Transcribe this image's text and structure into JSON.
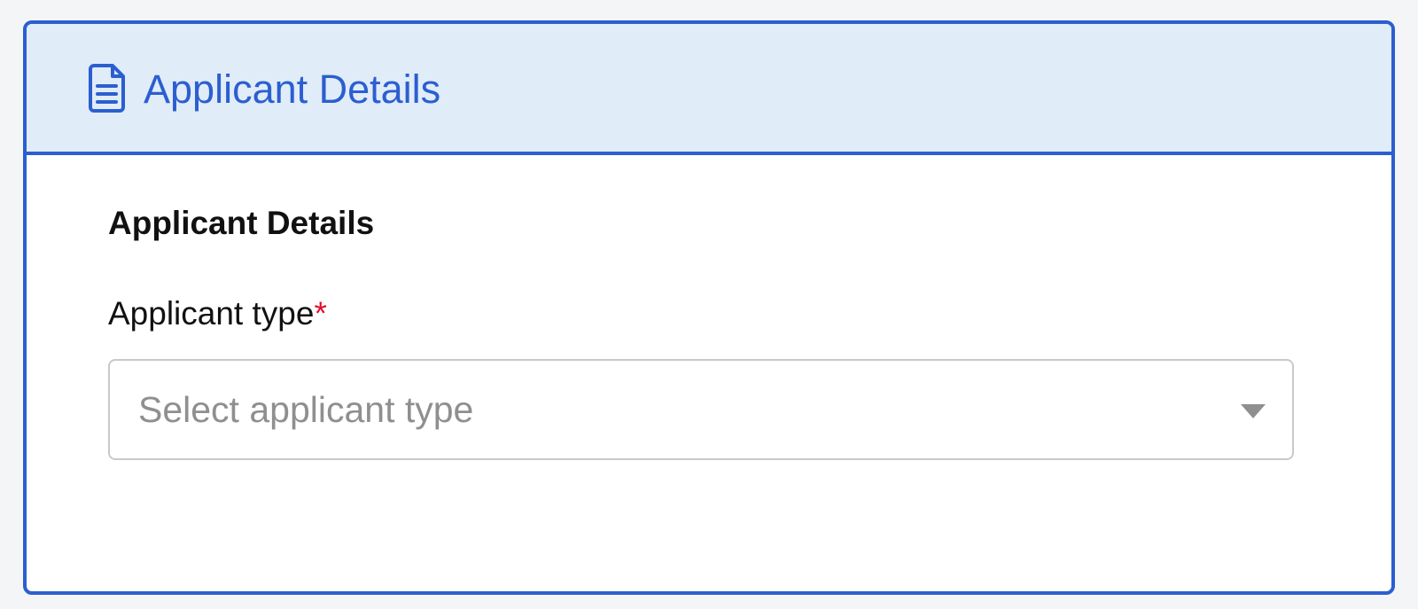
{
  "panel": {
    "header_title": "Applicant Details",
    "header_icon": "document-icon"
  },
  "form": {
    "section_title": "Applicant Details",
    "applicant_type": {
      "label": "Applicant type",
      "required_mark": "*",
      "placeholder": "Select applicant type",
      "dropdown_icon": "caret-down-icon"
    }
  },
  "colors": {
    "accent": "#2b5fd0",
    "header_background": "#e1ecf9",
    "required": "#e0112b",
    "placeholder_text": "#8f8f8f",
    "input_border": "#c9c9c9"
  }
}
